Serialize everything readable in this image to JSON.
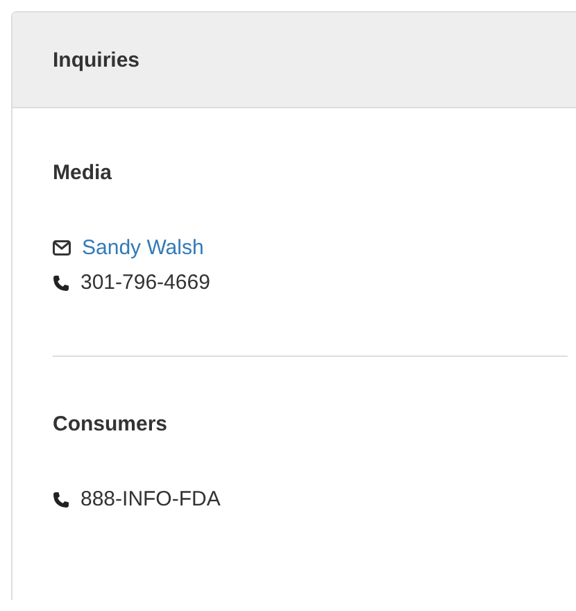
{
  "panel": {
    "title": "Inquiries"
  },
  "sections": [
    {
      "heading": "Media",
      "contacts": [
        {
          "kind": "email",
          "text": "Sandy Walsh"
        },
        {
          "kind": "phone",
          "text": "301-796-4669"
        }
      ]
    },
    {
      "heading": "Consumers",
      "contacts": [
        {
          "kind": "phone",
          "text": "888-INFO-FDA"
        }
      ]
    }
  ]
}
